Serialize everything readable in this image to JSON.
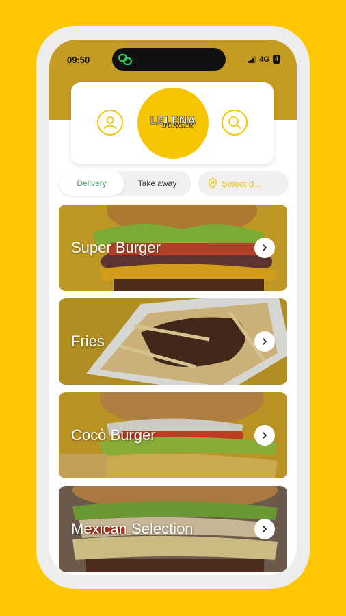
{
  "status": {
    "time": "09:50",
    "network": "4G",
    "battery": "4"
  },
  "header": {
    "logo_title": "LELENA",
    "logo_subtitle": "BURGER"
  },
  "icons": {
    "profile": "user-icon",
    "search": "search-icon",
    "location": "location-pin-icon",
    "arrow": "chevron-right-icon"
  },
  "filters": {
    "options": [
      "Delivery",
      "Take away"
    ],
    "active": "Delivery",
    "date_placeholder": "Select d..."
  },
  "categories": [
    {
      "label": "Super Burger"
    },
    {
      "label": "Fries"
    },
    {
      "label": "Cocò Burger"
    },
    {
      "label": "Mexican Selection"
    }
  ],
  "colors": {
    "background": "#FFC701",
    "brand_yellow": "#F7C500",
    "header": "#C49C23",
    "active_text": "#3FA264"
  }
}
